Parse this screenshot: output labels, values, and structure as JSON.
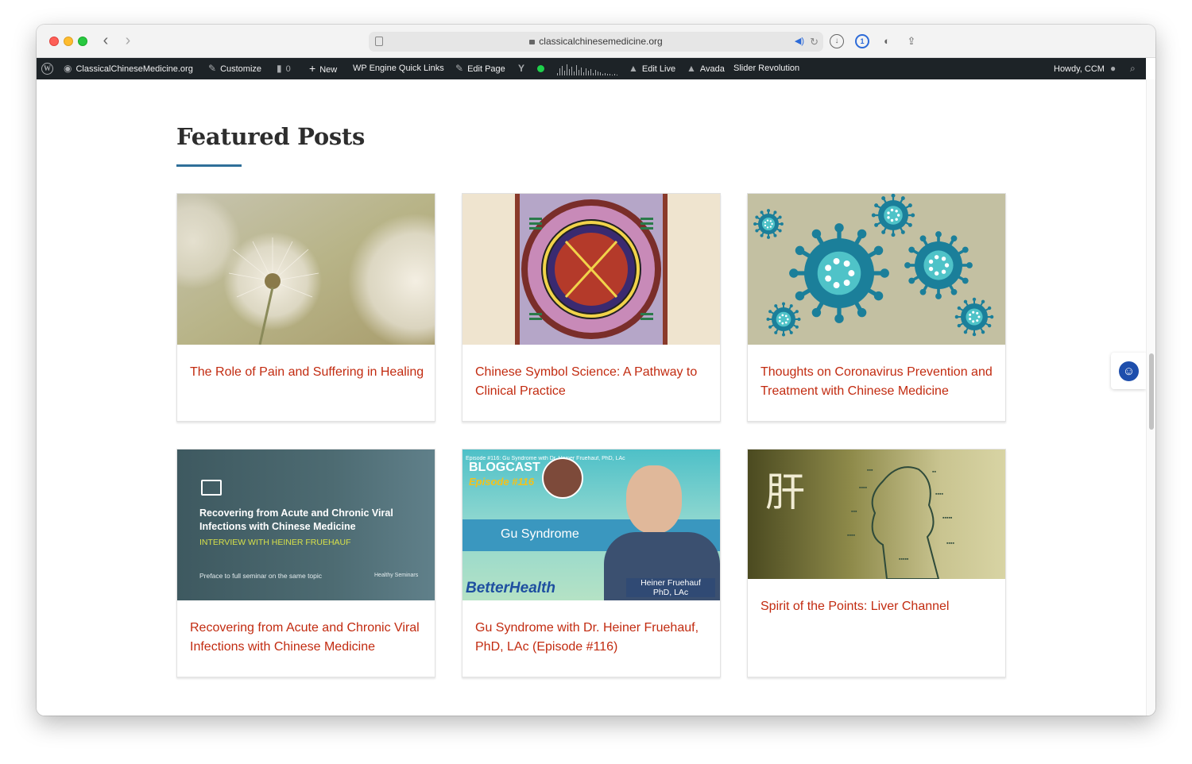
{
  "browser": {
    "url": "classicalchinesemedicine.org"
  },
  "adminbar": {
    "site_name": "ClassicalChineseMedicine.org",
    "customize": "Customize",
    "comments_count": "0",
    "new": "New",
    "quick_links": "WP Engine Quick Links",
    "edit_page": "Edit Page",
    "edit_live": "Edit Live",
    "avada": "Avada",
    "slider_revolution": "Slider Revolution",
    "greeting": "Howdy, CCM"
  },
  "section": {
    "title": "Featured Posts"
  },
  "posts": [
    {
      "title": "The Role of Pain and Suffering in Healing"
    },
    {
      "title": "Chinese Symbol Science: A Pathway to Clinical Practice"
    },
    {
      "title": "Thoughts on Coronavirus Prevention and Treatment with Chinese Medicine"
    },
    {
      "title": "Recovering from Acute and Chronic Viral Infections with Chinese Medicine"
    },
    {
      "title": "Gu Syndrome with Dr. Heiner Fruehauf, PhD, LAc (Episode #116)"
    },
    {
      "title": "Spirit of the Points: Liver Channel"
    }
  ],
  "thumb_text": {
    "seminar_title": "Recovering from Acute and Chronic Viral Infections with Chinese Medicine",
    "seminar_sub": "INTERVIEW WITH HEINER FRUEHAUF",
    "seminar_note": "Preface to full seminar on the same topic",
    "seminar_brand": "Healthy Seminars",
    "blogcast_top": "Episode #116: Gu Syndrome with Dr. Heiner Fruehauf, PhD, LAc",
    "blogcast": "BLOGCAST",
    "episode": "Episode #116",
    "gu": "Gu Syndrome",
    "brand": "BetterHealth",
    "person_name": "Heiner Fruehauf",
    "person_cred": "PhD, LAc",
    "liver_char": "肝"
  },
  "colors": {
    "accent": "#2f6f99",
    "post_link": "#c22b10",
    "adminbar": "#1d2327"
  }
}
